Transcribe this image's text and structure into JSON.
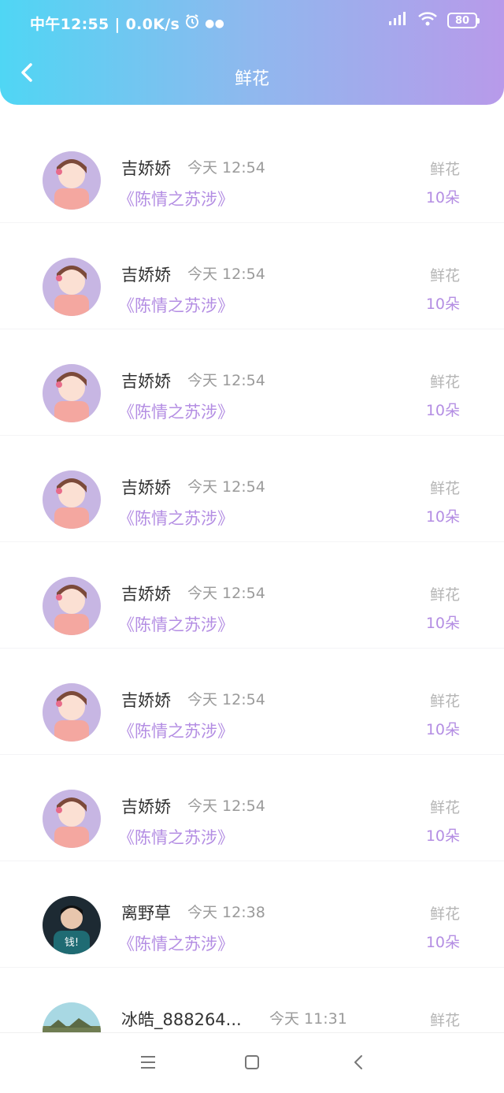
{
  "status_bar": {
    "time_speed": "中午12:55 | 0.0K/s",
    "battery": "80"
  },
  "header": {
    "title": "鲜花",
    "back_icon": "chevron-left-icon"
  },
  "items": [
    {
      "name": "吉娇娇",
      "time": "今天 12:54",
      "novel": "《陈情之苏涉》",
      "gift_type": "鲜花",
      "gift_count": "10朵",
      "avatar": "girl"
    },
    {
      "name": "吉娇娇",
      "time": "今天 12:54",
      "novel": "《陈情之苏涉》",
      "gift_type": "鲜花",
      "gift_count": "10朵",
      "avatar": "girl"
    },
    {
      "name": "吉娇娇",
      "time": "今天 12:54",
      "novel": "《陈情之苏涉》",
      "gift_type": "鲜花",
      "gift_count": "10朵",
      "avatar": "girl"
    },
    {
      "name": "吉娇娇",
      "time": "今天 12:54",
      "novel": "《陈情之苏涉》",
      "gift_type": "鲜花",
      "gift_count": "10朵",
      "avatar": "girl"
    },
    {
      "name": "吉娇娇",
      "time": "今天 12:54",
      "novel": "《陈情之苏涉》",
      "gift_type": "鲜花",
      "gift_count": "10朵",
      "avatar": "girl"
    },
    {
      "name": "吉娇娇",
      "time": "今天 12:54",
      "novel": "《陈情之苏涉》",
      "gift_type": "鲜花",
      "gift_count": "10朵",
      "avatar": "girl"
    },
    {
      "name": "吉娇娇",
      "time": "今天 12:54",
      "novel": "《陈情之苏涉》",
      "gift_type": "鲜花",
      "gift_count": "10朵",
      "avatar": "girl"
    },
    {
      "name": "离野草",
      "time": "今天 12:38",
      "novel": "《陈情之苏涉》",
      "gift_type": "鲜花",
      "gift_count": "10朵",
      "avatar": "man",
      "avatar_text": "钱!"
    },
    {
      "name": "冰皓_888264...",
      "time": "今天 11:31",
      "novel": "",
      "gift_type": "鲜花",
      "gift_count": "",
      "avatar": "landscape"
    }
  ],
  "bottom_nav": {
    "menu_icon": "menu-icon",
    "home_icon": "home-square-icon",
    "back_icon": "triangle-back-icon"
  },
  "colors": {
    "accent": "#b48ee3",
    "gradient_start": "#4fd6f4",
    "gradient_end": "#b89aea"
  }
}
